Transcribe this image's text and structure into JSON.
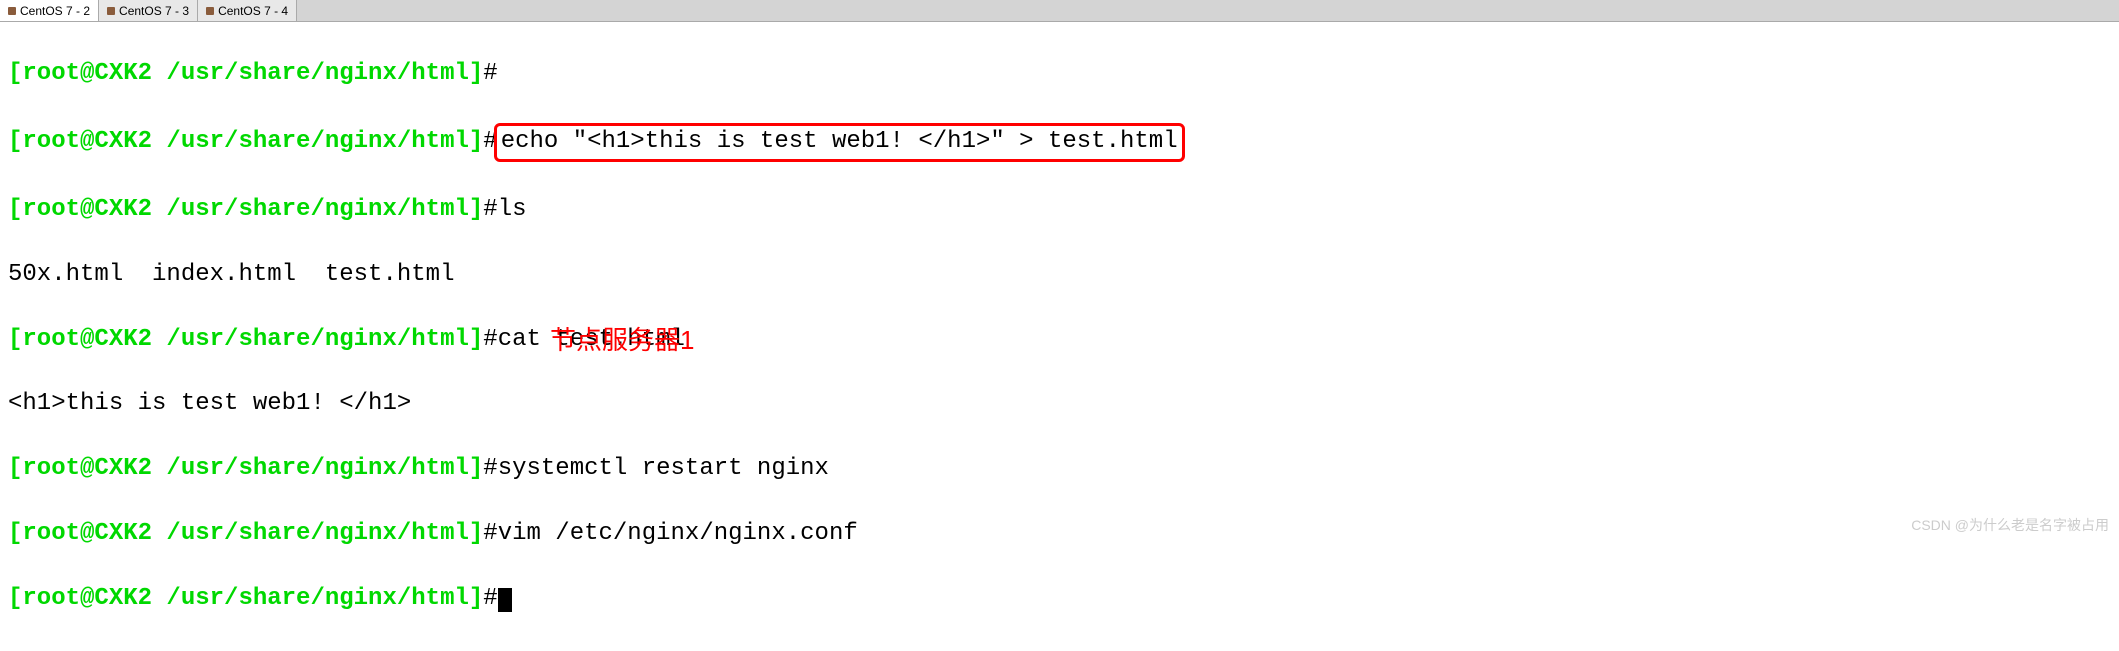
{
  "tabs": [
    {
      "label": "CentOS 7 - 2"
    },
    {
      "label": "CentOS 7 - 3"
    },
    {
      "label": "CentOS 7 - 4"
    }
  ],
  "prompt_text": "[root@CXK2 /usr/share/nginx/html]",
  "hash": "#",
  "lines": {
    "l1_cmd": "",
    "l2_cmd": "echo \"<h1>this is test web1! </h1>\" > test.html",
    "l3_cmd": "ls",
    "l4_out": "50x.html  index.html  test.html",
    "l5_cmd": "cat test.html",
    "l6_out": "<h1>this is test web1! </h1>",
    "l7_cmd": "systemctl restart nginx",
    "l8_cmd": "vim /etc/nginx/nginx.conf",
    "l9_cmd": ""
  },
  "annotation": "节点服务器1",
  "watermark": "CSDN @为什么老是名字被占用"
}
